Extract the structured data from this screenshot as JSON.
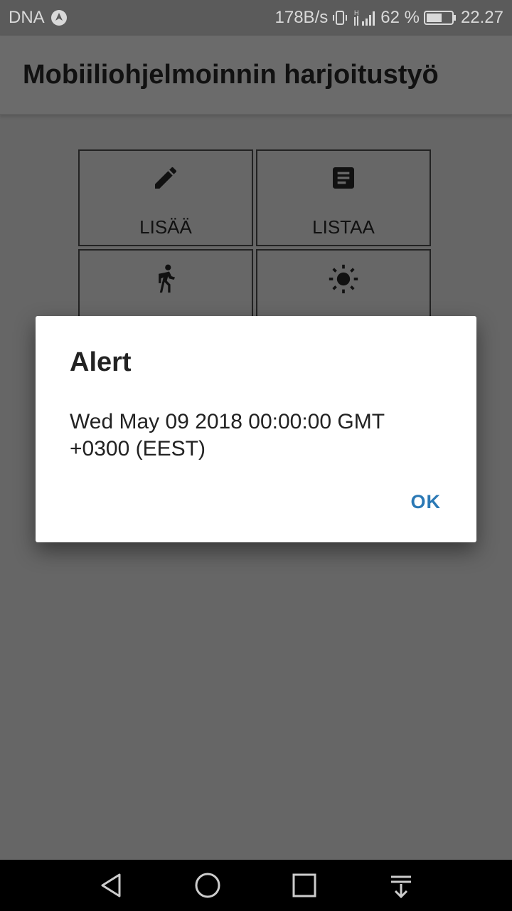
{
  "status_bar": {
    "carrier": "DNA",
    "data_rate": "178B/s",
    "network_type": "H",
    "battery_percent": "62 %",
    "battery_level": 0.62,
    "time": "22.27"
  },
  "app_bar": {
    "title": "Mobiiliohjelmoinnin harjoitustyö"
  },
  "tiles": [
    {
      "label": "LISÄÄ",
      "icon": "pencil-icon"
    },
    {
      "label": "LISTAA",
      "icon": "document-list-icon"
    },
    {
      "label": "",
      "icon": "walking-person-icon"
    },
    {
      "label": "",
      "icon": "sun-icon"
    }
  ],
  "dialog": {
    "title": "Alert",
    "message": "Wed May 09 2018 00:00:00 GMT +0300 (EEST)",
    "ok_label": "OK"
  },
  "nav_bar": {
    "buttons": [
      "back-icon",
      "home-icon",
      "recents-icon",
      "notification-pull-icon"
    ]
  },
  "colors": {
    "scrim": "#666666",
    "dialog_bg": "#ffffff",
    "accent": "#2b79b5"
  }
}
